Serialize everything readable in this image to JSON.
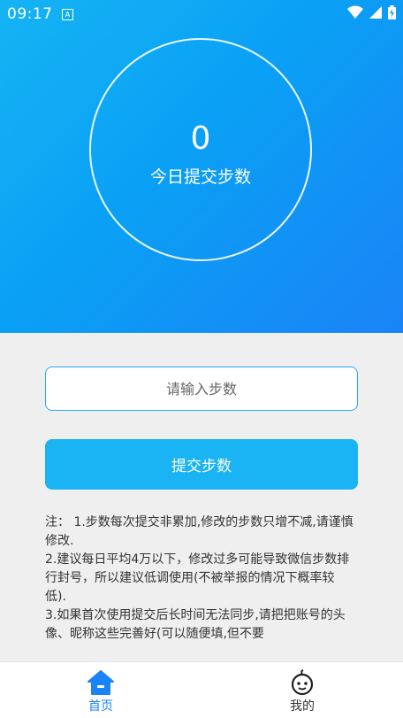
{
  "status": {
    "time": "09:17",
    "notification_letter": "A"
  },
  "hero": {
    "count": "0",
    "label": "今日提交步数"
  },
  "form": {
    "input_placeholder": "请输入步数",
    "submit_label": "提交步数"
  },
  "notes": [
    "注： 1.步数每次提交非累加,修改的步数只增不减,请谨慎修改.",
    "2.建议每日平均4万以下，修改过多可能导致微信步数排行封号，所以建议低调使用(不被举报的情况下概率较低).",
    "3.如果首次使用提交后长时间无法同步,请把把账号的头像、昵称这些完善好(可以随便填,但不要"
  ],
  "tabs": [
    {
      "label": "首页",
      "icon": "home-icon",
      "active": true
    },
    {
      "label": "我的",
      "icon": "profile-face-icon",
      "active": false
    }
  ],
  "colors": {
    "accent": "#1ab3f4",
    "active_tab": "#1a83f6",
    "background": "#efefef"
  }
}
